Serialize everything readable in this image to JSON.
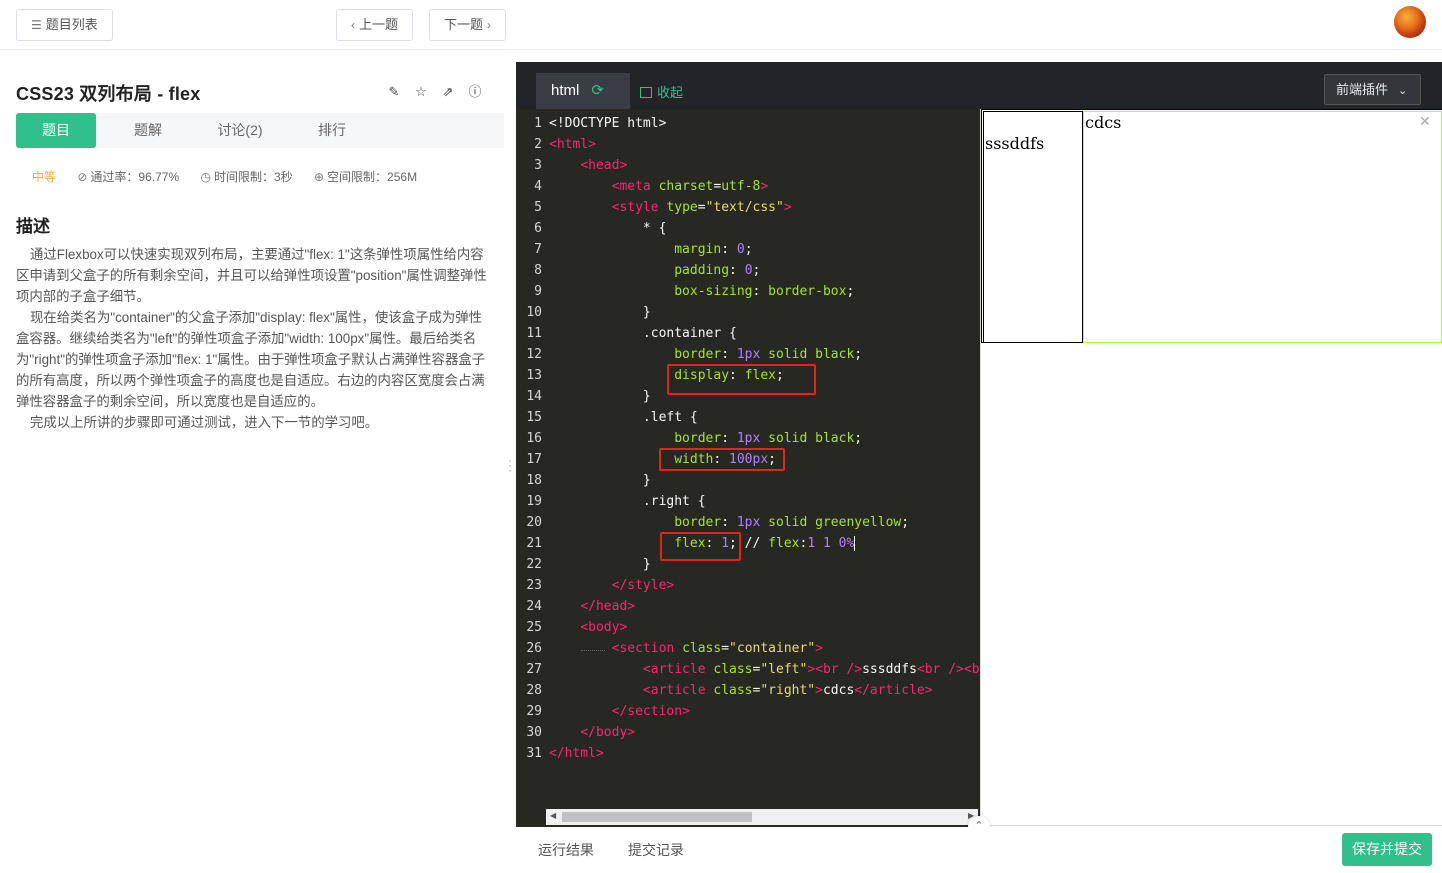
{
  "topbar": {
    "list_label": "题目列表",
    "prev_label": "上一题",
    "next_label": "下一题"
  },
  "problem": {
    "title": "CSS23  双列布局 - flex",
    "tabs": [
      "题目",
      "题解",
      "讨论(2)",
      "排行"
    ],
    "difficulty": "中等",
    "pass_rate": "通过率：96.77%",
    "time_limit": "时间限制：3秒",
    "mem_limit": "空间限制：256M",
    "desc_heading": "描述",
    "paragraphs": [
      "通过Flexbox可以快速实现双列布局，主要通过\"flex: 1\"这条弹性项属性给内容区申请到父盒子的所有剩余空间，并且可以给弹性项设置\"position\"属性调整弹性项内部的子盒子细节。",
      "现在给类名为\"container\"的父盒子添加\"display: flex\"属性，使该盒子成为弹性盒容器。继续给类名为\"left\"的弹性项盒子添加\"width: 100px\"属性。最后给类名为\"right\"的弹性项盒子添加\"flex: 1\"属性。由于弹性项盒子默认占满弹性容器盒子的所有高度，所以两个弹性项盒子的高度也是自适应。右边的内容区宽度会占满弹性容器盒子的剩余空间，所以宽度也是自适应的。",
      "完成以上所讲的步骤即可通过测试，进入下一节的学习吧。"
    ]
  },
  "editor": {
    "tab_label": "html",
    "collapse_label": "收起",
    "plugin_label": "前端插件",
    "line_numbers": [
      "1",
      "2",
      "3",
      "4",
      "5",
      "6",
      "7",
      "8",
      "9",
      "10",
      "11",
      "12",
      "13",
      "14",
      "15",
      "16",
      "17",
      "18",
      "19",
      "20",
      "21",
      "22",
      "23",
      "24",
      "25",
      "26",
      "27",
      "28",
      "29",
      "30",
      "31"
    ]
  },
  "preview": {
    "left_text": "sssddfs",
    "right_text": "cdcs"
  },
  "bottom": {
    "run_result": "运行结果",
    "submit_record": "提交记录",
    "submit_button": "保存并提交"
  },
  "colors": {
    "accent": "#32c08a",
    "editor_bg": "#272822",
    "highlight_box": "#e8231c",
    "right_border": "#adff2f"
  }
}
